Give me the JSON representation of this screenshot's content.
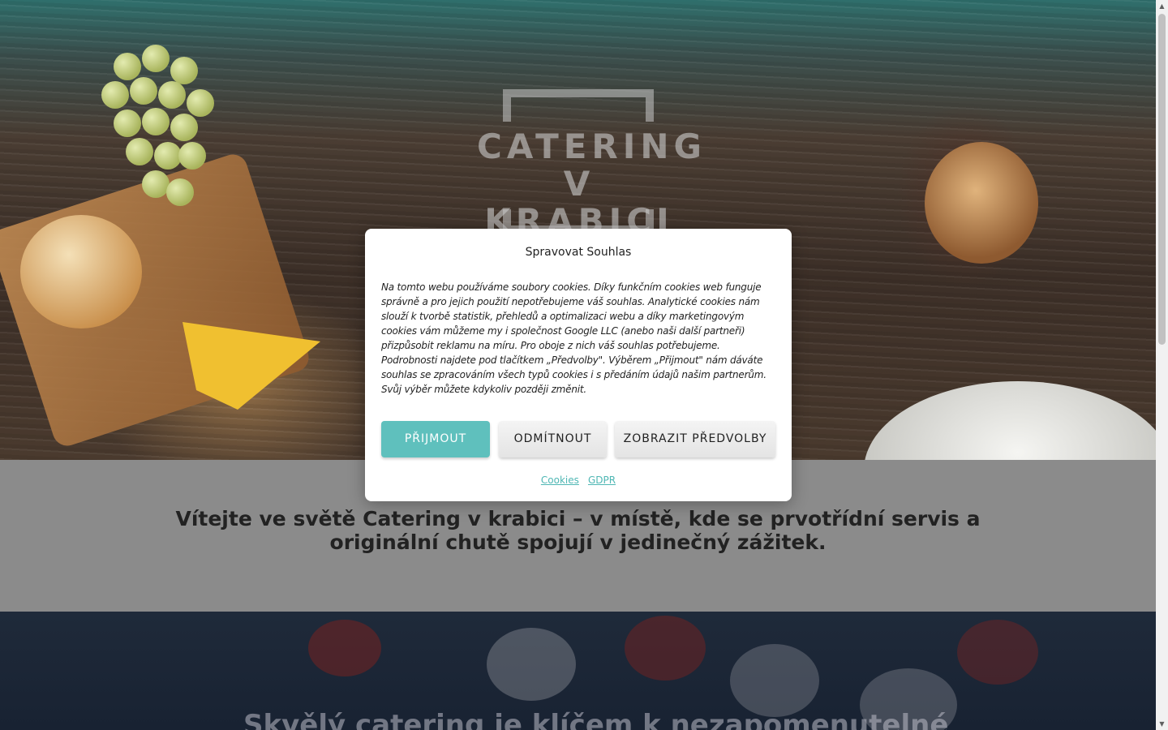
{
  "hero": {
    "logo_line1": "CATERING",
    "logo_line2": "V KRABICI"
  },
  "welcome": {
    "heading": "Vítejte ve světě Catering v krabici – v místě, kde se prvotřídní servis a originální chutě spojují v jedinečný zážitek."
  },
  "section2": {
    "heading": "Skvělý catering je klíčem k nezapomenutelné"
  },
  "cookie_modal": {
    "title": "Spravovat Souhlas",
    "text": "Na tomto webu používáme soubory cookies. Díky funkčním cookies web funguje správně a pro jejich použití nepotřebujeme váš souhlas. Analytické cookies nám slouží k tvorbě statistik, přehledů a optimalizaci webu a díky marketingovým cookies vám můžeme my i společnost Google LLC (anebo naši další partneři) přizpůsobit reklamu na míru. Pro oboje z nich váš souhlas potřebujeme. Podrobnosti najdete pod tlačítkem „Předvolby\". Výběrem „Přijmout\" nám dáváte souhlas se zpracováním všech typů cookies i s předáním údajů našim partnerům. Svůj výběr můžete kdykoliv později změnit.",
    "accept_label": "PŘIJMOUT",
    "deny_label": "ODMÍTNOUT",
    "prefs_label": "ZOBRAZIT PŘEDVOLBY",
    "link_cookies": "Cookies",
    "link_gdpr": "GDPR"
  },
  "colors": {
    "accent": "#5fc0bd",
    "link": "#4fb7b4",
    "modal_bg": "#ffffff"
  }
}
